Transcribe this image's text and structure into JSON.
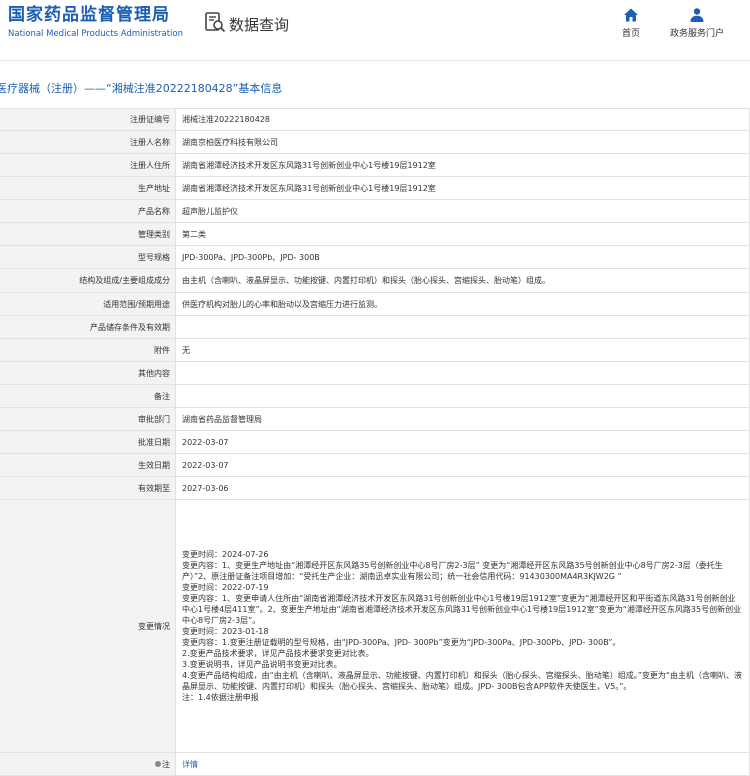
{
  "header": {
    "logo_cn": "国家药品监督管理局",
    "logo_en": "National Medical Products Administration",
    "search_title": "数据查询",
    "nav": [
      {
        "label": "首页",
        "icon": "home-icon"
      },
      {
        "label": "政务服务门户",
        "icon": "user-icon"
      }
    ]
  },
  "page_title": "医疗器械（注册）——“湘械注准20222180428”基本信息",
  "record": {
    "labels": {
      "reg_no": "注册证编号",
      "registrant": "注册人名称",
      "registrant_addr": "注册人住所",
      "production_addr": "生产地址",
      "product_name": "产品名称",
      "category": "管理类别",
      "model": "型号规格",
      "structure": "结构及组成/主要组成成分",
      "scope": "适用范围/预期用途",
      "storage": "产品储存条件及有效期",
      "attachment": "附件",
      "other": "其他内容",
      "remark": "备注",
      "dept": "审批部门",
      "approve_date": "批准日期",
      "effective_date": "生效日期",
      "expire_date": "有效期至",
      "change": "变更情况",
      "note": "注"
    },
    "values": {
      "reg_no": "湘械注准20222180428",
      "registrant": "湖南京柏医疗科技有限公司",
      "registrant_addr": "湖南省湘潭经济技术开发区东风路31号创新创业中心1号楼19层1912室",
      "production_addr": "湖南省湘潭经济技术开发区东风路31号创新创业中心1号楼19层1912室",
      "product_name": "超声胎儿监护仪",
      "category": "第二类",
      "model": "JPD-300Pa、JPD-300Pb、JPD- 300B",
      "structure": "由主机（含喇叭、液晶屏显示、功能按键、内置打印机）和探头（胎心探头、宫缩探头、胎动笔）组成。",
      "scope": "供医疗机构对胎儿的心率和胎动以及宫缩压力进行监测。",
      "storage": "",
      "attachment": "无",
      "other": "",
      "remark": "",
      "dept": "湖南省药品监督管理局",
      "approve_date": "2022-03-07",
      "effective_date": "2022-03-07",
      "expire_date": "2027-03-06",
      "change_lines": [
        "变更时间：2024-07-26",
        "变更内容：1、变更生产地址由“湘潭经开区东风路35号创新创业中心8号厂房2-3层” 变更为“湘潭经开区东风路35号创新创业中心8号厂房2-3层（委托生产）”2、原注册证备注项目增加：“受托生产企业：湖南迅卓实业有限公司；统一社会信用代码：91430300MA4R3KJW2G ”",
        "变更时间：2022-07-19",
        "变更内容：1、变更申请人住所由“湖南省湘潭经济技术开发区东风路31号创新创业中心1号楼19层1912室”变更为“湘潭经开区和平街道东风路31号创新创业中心1号楼4层411室”。2、变更生产地址由“湖南省湘潭经济技术开发区东风路31号创新创业中心1号楼19层1912室”变更为“湘潭经开区东风路35号创新创业中心8号厂房2-3层”。",
        "变更时间：2023-01-18",
        "变更内容：1.变更注册证载明的型号规格，由“JPD-300Pa、JPD- 300Pb”变更为“JPD-300Pa、JPD-300Pb、JPD- 300B”。",
        "2.变更产品技术要求，详见产品技术要求变更对比表。",
        "3.变更说明书，详见产品说明书变更对比表。",
        "4.变更产品结构组成，由“由主机（含喇叭、液晶屏显示、功能按键、内置打印机）和探头（胎心探头、宫缩探头、胎动笔）组成。”变更为“由主机（含喇叭、液晶屏显示、功能按键、内置打印机）和探头（胎心探头、宫缩探头、胎动笔）组成。JPD- 300B包含APP软件天使医生，V5。”。",
        "注：1.4依据注册申报"
      ],
      "note": "详情"
    }
  },
  "colors": {
    "brand_blue": "#1a5fb4",
    "label_bg": "#f3f3f3",
    "border": "#e2e2e2"
  }
}
